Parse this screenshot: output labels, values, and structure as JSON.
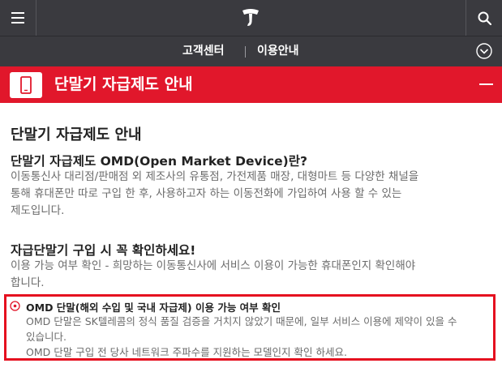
{
  "header": {
    "menu_icon": "hamburger-menu-icon",
    "logo_icon": "t-logo-icon",
    "search_icon": "search-icon"
  },
  "subnav": {
    "item1": "고객센터",
    "item2": "이용안내"
  },
  "banner": {
    "title": "단말기 자급제도 안내",
    "accent": "#e1172b"
  },
  "content": {
    "heading": "단말기 자급제도 안내",
    "q_title": "단말기 자급제도 OMD(Open Market Device)란?",
    "q_lines": [
      "이동통신사 대리점/판매점 외 제조사의 유통점, 가전제품 매장, 대형마트 등 다양한 채널을",
      "통해 휴대폰만 따로 구입 한 후, 사용하고자 하는 이동전화에 가입하여 사용 할 수 있는",
      "제도입니다."
    ],
    "check_title": "자급단말기 구입 시 꼭 확인하세요!",
    "check_lines": [
      "이용 가능 여부 확인 - 희망하는 이동통신사에 서비스 이용이 가능한 휴대폰인지 확인해야",
      "합니다."
    ],
    "box": {
      "title": "OMD 단말(해외 수입 및 국내 자급제) 이용 가능 여부 확인",
      "lines": [
        "OMD 단말은 SK텔레콤의 정식 품질 검증을 거치지 않았기 때문에, 일부 서비스 이용에 제약이 있을 수",
        "있습니다.",
        "OMD 단말 구입 전 당사 네트워크 주파수를 지원하는 모델인지 확인 하세요."
      ]
    }
  }
}
